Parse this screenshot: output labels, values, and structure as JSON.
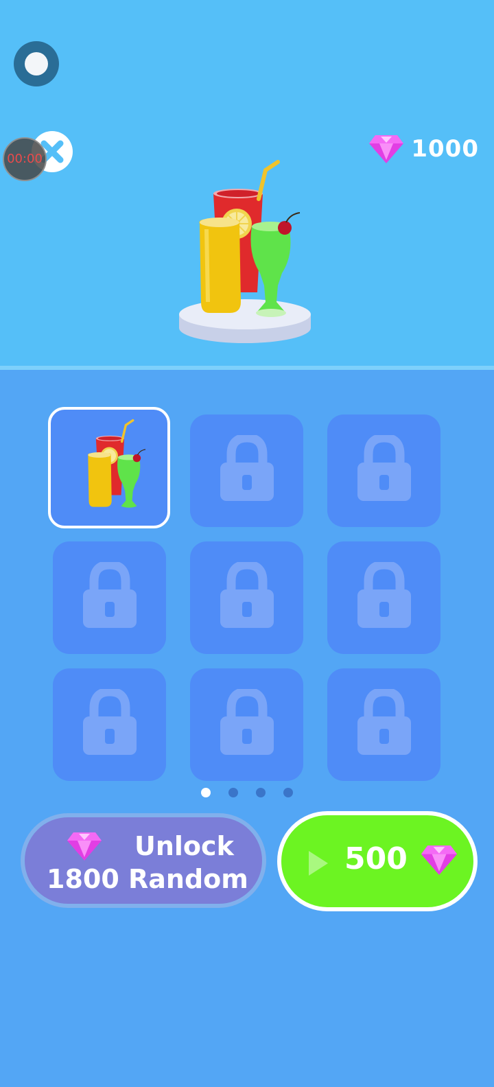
{
  "hud": {
    "timer": "00:00",
    "currency_value": "1000"
  },
  "skins": {
    "pages": 4,
    "active_page": 0,
    "items": [
      {
        "state": "selected",
        "item": "drinks"
      },
      {
        "state": "locked",
        "item": "lock-icon"
      },
      {
        "state": "locked",
        "item": "lock-icon"
      },
      {
        "state": "locked",
        "item": "lock-icon"
      },
      {
        "state": "locked",
        "item": "lock-icon"
      },
      {
        "state": "locked",
        "item": "lock-icon"
      },
      {
        "state": "locked",
        "item": "lock-icon"
      },
      {
        "state": "locked",
        "item": "lock-icon"
      },
      {
        "state": "locked",
        "item": "lock-icon"
      }
    ]
  },
  "actions": {
    "unlock_line1": "Unlock",
    "unlock_line2": "1800 Random",
    "ad_reward_value": "500"
  },
  "colors": {
    "top_bg": "#55bff8",
    "bottom_bg": "#53a6f5",
    "tile": "#4f8cf7",
    "gem": "#e23ee4",
    "unlock_button": "#7b7ed8",
    "ad_button": "#6cf422"
  },
  "icons": [
    "record-icon",
    "close-icon",
    "gem-icon",
    "lock-icon",
    "play-icon"
  ]
}
